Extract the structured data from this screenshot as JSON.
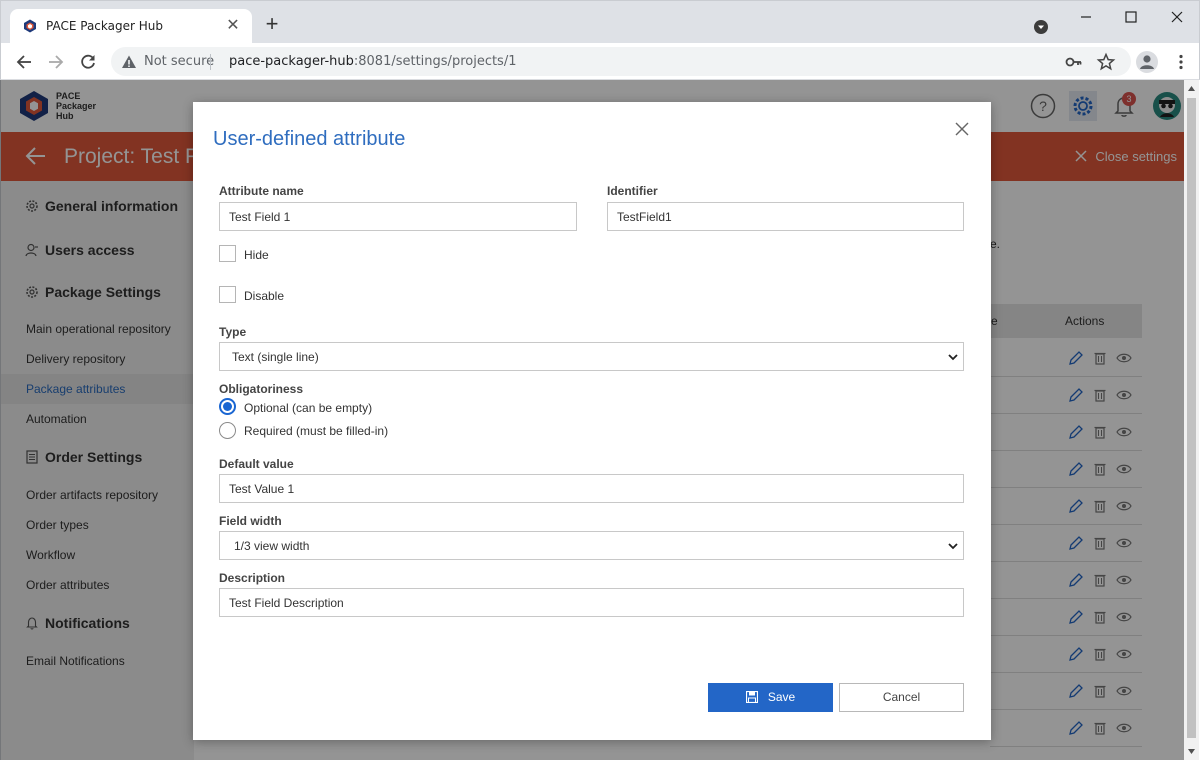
{
  "browser": {
    "tab_title": "PACE Packager Hub",
    "security_label": "Not secure",
    "url_host": "pace-packager-hub",
    "url_path": ":8081/settings/projects/1"
  },
  "app": {
    "logo_text": "PACE Packager Hub",
    "notification_count": "3",
    "project_title": "Project: Test P",
    "close_settings": "Close settings"
  },
  "sidebar": {
    "general_information": "General information",
    "users_access": "Users access",
    "package_settings": "Package Settings",
    "package_items": [
      "Main operational repository",
      "Delivery repository",
      "Package attributes",
      "Automation"
    ],
    "order_settings": "Order Settings",
    "order_items": [
      "Order artifacts repository",
      "Order types",
      "Workflow",
      "Order attributes"
    ],
    "notifications": "Notifications",
    "notification_items": [
      "Email Notifications"
    ]
  },
  "background": {
    "text_fragment": "e.",
    "column_fragment": "e",
    "actions_header": "Actions"
  },
  "modal": {
    "title": "User-defined attribute",
    "attribute_name_label": "Attribute name",
    "attribute_name_value": "Test Field 1",
    "identifier_label": "Identifier",
    "identifier_value": "TestField1",
    "hide_label": "Hide",
    "disable_label": "Disable",
    "type_label": "Type",
    "type_value": "Text (single line)",
    "obligatoriness_label": "Obligatoriness",
    "optional_label": "Optional (can be empty)",
    "required_label": "Required (must be filled-in)",
    "default_value_label": "Default value",
    "default_value": "Test Value 1",
    "field_width_label": "Field width",
    "field_width_value": "1/3 view width",
    "description_label": "Description",
    "description_value": "Test Field Description",
    "save_label": "Save",
    "cancel_label": "Cancel"
  },
  "colors": {
    "accent": "#2366c7",
    "project_bar": "#e0593c",
    "title_blue": "#2f6dbf"
  }
}
